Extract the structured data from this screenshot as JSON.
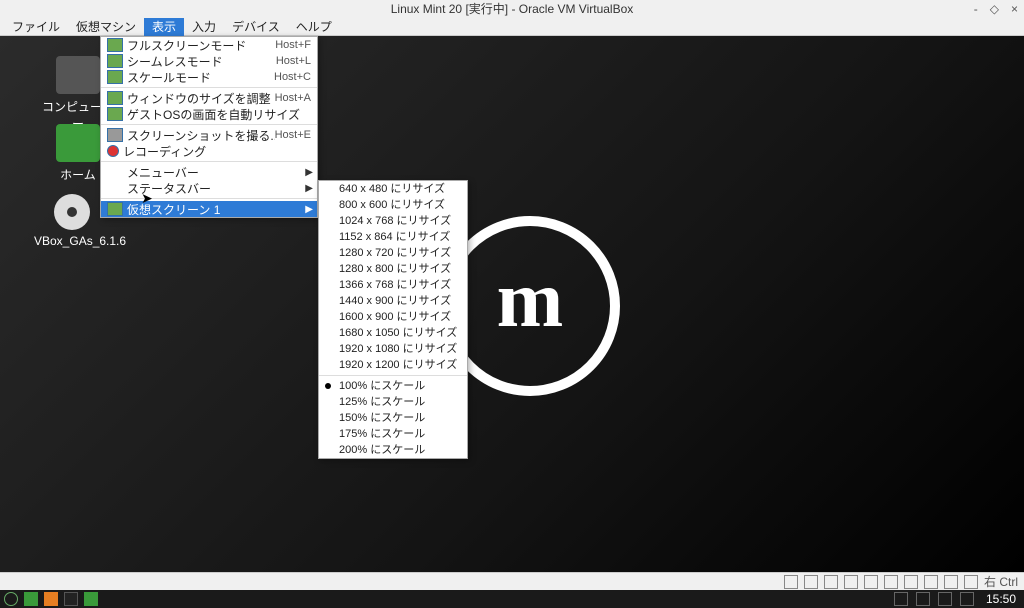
{
  "title": "Linux Mint 20 [実行中] - Oracle VM VirtualBox",
  "menubar": {
    "items": [
      "ファイル",
      "仮想マシン",
      "表示",
      "入力",
      "デバイス",
      "ヘルプ"
    ],
    "active_index": 2
  },
  "desktop": {
    "icons": [
      {
        "label": "コンピューター"
      },
      {
        "label": "ホーム"
      },
      {
        "label": "VBox_GAs_6.1.6"
      }
    ]
  },
  "view_menu": {
    "items": [
      {
        "icon": "screen",
        "label": "フルスクリーンモード",
        "shortcut": "Host+F"
      },
      {
        "icon": "screen",
        "label": "シームレスモード",
        "shortcut": "Host+L"
      },
      {
        "icon": "screen",
        "label": "スケールモード",
        "shortcut": "Host+C"
      },
      {
        "sep": true
      },
      {
        "icon": "screen",
        "label": "ウィンドウのサイズを調整",
        "shortcut": "Host+A"
      },
      {
        "icon": "screen",
        "label": "ゲストOSの画面を自動リサイズ",
        "shortcut": ""
      },
      {
        "sep": true
      },
      {
        "icon": "camera",
        "label": "スクリーンショットを撮る...",
        "shortcut": "Host+E"
      },
      {
        "icon": "rec",
        "label": "レコーディング",
        "shortcut": ""
      },
      {
        "sep": true
      },
      {
        "icon": "none",
        "label": "メニューバー",
        "submenu": true
      },
      {
        "icon": "none",
        "label": "ステータスバー",
        "submenu": true
      },
      {
        "sep": true
      },
      {
        "icon": "screen",
        "label": "仮想スクリーン 1",
        "submenu": true,
        "highlight": true
      }
    ]
  },
  "virtual_screen_submenu": {
    "resize": [
      "640 x 480 にリサイズ",
      "800 x 600 にリサイズ",
      "1024 x 768 にリサイズ",
      "1152 x 864 にリサイズ",
      "1280 x 720 にリサイズ",
      "1280 x 800 にリサイズ",
      "1366 x 768 にリサイズ",
      "1440 x 900 にリサイズ",
      "1600 x 900 にリサイズ",
      "1680 x 1050 にリサイズ",
      "1920 x 1080 にリサイズ",
      "1920 x 1200 にリサイズ"
    ],
    "scale": [
      "100% にスケール",
      "125% にスケール",
      "150% にスケール",
      "175% にスケール",
      "200% にスケール"
    ],
    "scale_selected_index": 0
  },
  "statusbar": {
    "host_key": "右 Ctrl"
  },
  "taskbar": {
    "clock": "15:50"
  }
}
